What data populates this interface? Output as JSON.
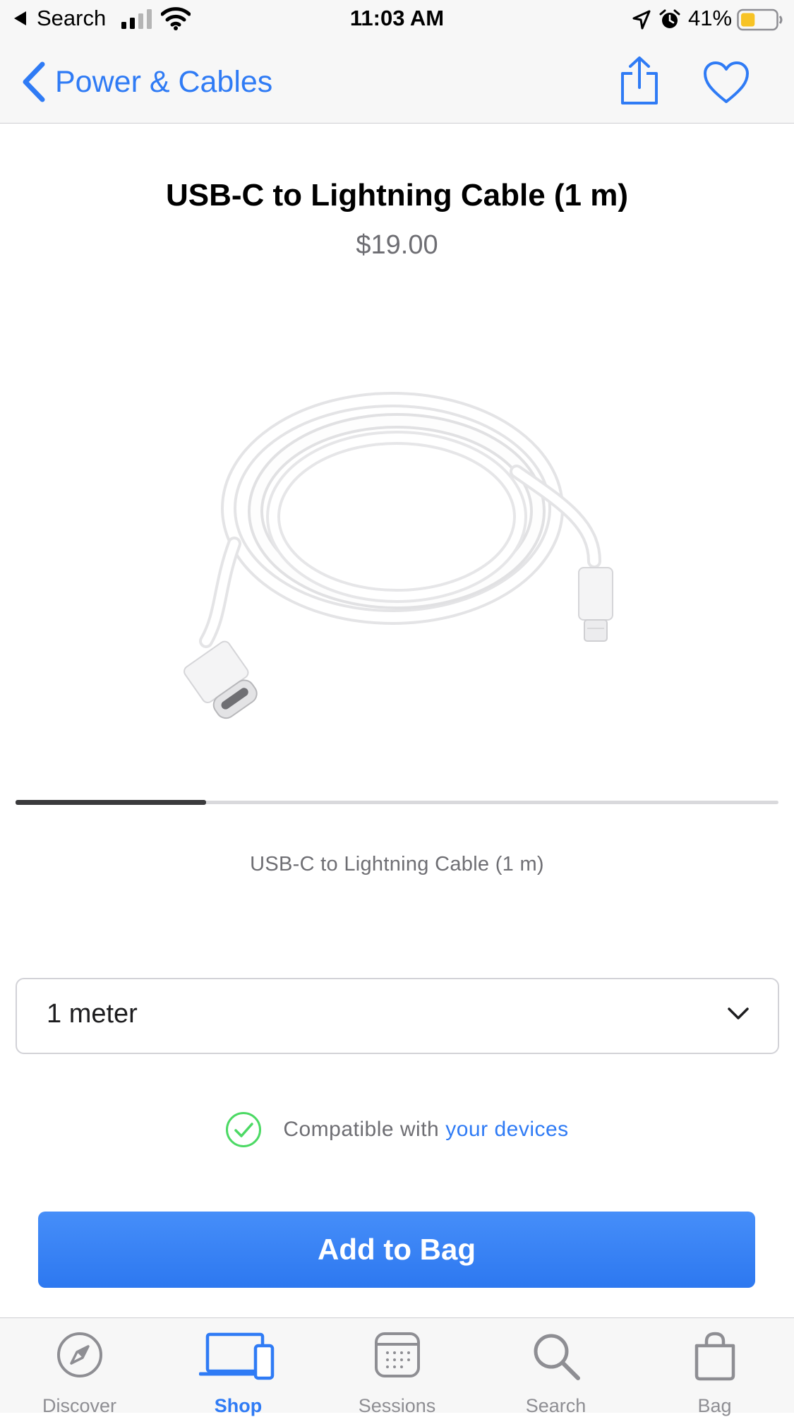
{
  "status_bar": {
    "back_label": "Search",
    "time": "11:03 AM",
    "battery_percent": "41%",
    "battery_level": 0.41,
    "signal_bars": 2,
    "icons": [
      "back-arrow-icon",
      "cellular-signal-icon",
      "wifi-icon",
      "location-icon",
      "alarm-icon",
      "battery-icon"
    ]
  },
  "nav": {
    "back_label": "Power & Cables",
    "icons": [
      "chevron-left-icon",
      "share-icon",
      "heart-icon"
    ]
  },
  "product": {
    "title": "USB-C to Lightning Cable (1 m)",
    "price": "$19.00",
    "image_caption": "USB-C to Lightning Cable (1 m)",
    "gallery_progress": 0.25
  },
  "options": {
    "selected": "1 meter"
  },
  "compatibility": {
    "text": "Compatible with",
    "link": "your devices"
  },
  "actions": {
    "add_to_bag": "Add to Bag"
  },
  "tabs": [
    {
      "label": "Discover",
      "icon": "compass-icon",
      "active": false
    },
    {
      "label": "Shop",
      "icon": "devices-icon",
      "active": true
    },
    {
      "label": "Sessions",
      "icon": "calendar-icon",
      "active": false
    },
    {
      "label": "Search",
      "icon": "search-icon",
      "active": false
    },
    {
      "label": "Bag",
      "icon": "bag-icon",
      "active": false
    }
  ],
  "colors": {
    "accent": "#2f7bf5",
    "check_green": "#4cd964",
    "battery_yellow": "#f7c325"
  }
}
